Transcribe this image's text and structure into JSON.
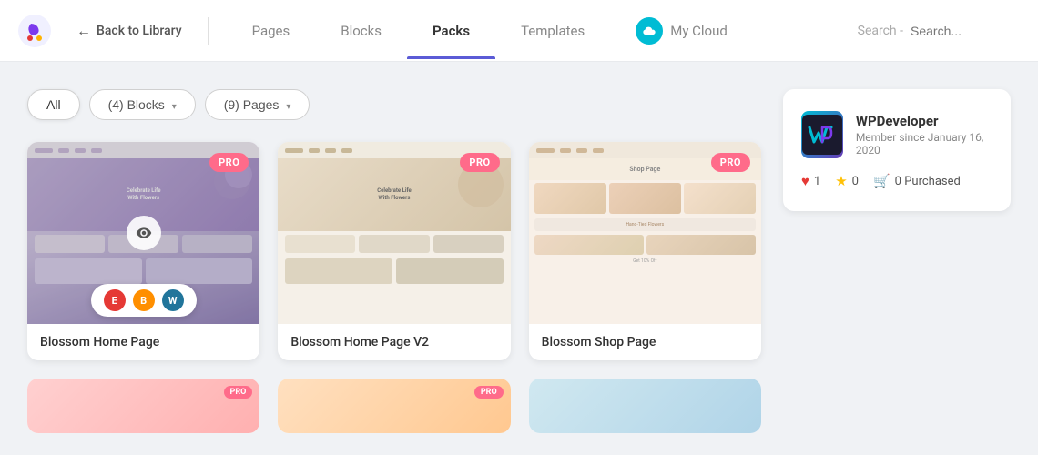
{
  "header": {
    "back_label": "Back to Library",
    "nav_tabs": [
      {
        "id": "pages",
        "label": "Pages",
        "active": false,
        "has_cloud": false
      },
      {
        "id": "blocks",
        "label": "Blocks",
        "active": false,
        "has_cloud": false
      },
      {
        "id": "packs",
        "label": "Packs",
        "active": true,
        "has_cloud": false
      },
      {
        "id": "templates",
        "label": "Templates",
        "active": false,
        "has_cloud": false
      },
      {
        "id": "my-cloud",
        "label": "My Cloud",
        "active": false,
        "has_cloud": true
      }
    ],
    "search": {
      "label": "Search -",
      "placeholder": "Search..."
    }
  },
  "filters": {
    "all_label": "All",
    "blocks_label": "(4)  Blocks",
    "pages_label": "(9)  Pages"
  },
  "cards": [
    {
      "id": "card-1",
      "title": "Blossom Home Page",
      "badge": "PRO",
      "has_eye": true,
      "has_editor_bar": true,
      "thumb_variant": "purple"
    },
    {
      "id": "card-2",
      "title": "Blossom Home Page V2",
      "badge": "PRO",
      "has_eye": false,
      "has_editor_bar": false,
      "thumb_variant": "beige"
    },
    {
      "id": "card-3",
      "title": "Blossom Shop Page",
      "badge": "PRO",
      "has_eye": false,
      "has_editor_bar": false,
      "thumb_variant": "shop"
    }
  ],
  "editor_icons": [
    {
      "id": "el",
      "label": "E",
      "title": "Elementor"
    },
    {
      "id": "beaver",
      "label": "B",
      "title": "Beaver Builder"
    },
    {
      "id": "wp",
      "label": "W",
      "title": "WordPress"
    }
  ],
  "sidebar": {
    "developer_name": "WPDeveloper",
    "member_since": "Member since January 16, 2020",
    "stats": {
      "likes": "1",
      "stars": "0",
      "purchased": "0 Purchased"
    },
    "likes_label": "1",
    "stars_label": "0",
    "purchased_label": "0 Purchased"
  }
}
